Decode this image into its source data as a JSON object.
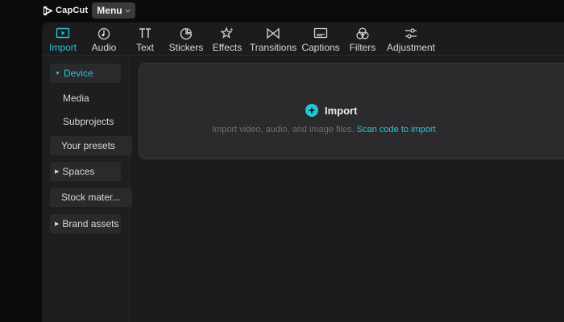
{
  "brand": {
    "name": "CapCut"
  },
  "menu": {
    "label": "Menu"
  },
  "toolbar": {
    "accent": "#2bc4d6",
    "items": [
      {
        "label": "Import",
        "icon": "import-icon",
        "active": true
      },
      {
        "label": "Audio",
        "icon": "audio-icon"
      },
      {
        "label": "Text",
        "icon": "text-icon"
      },
      {
        "label": "Stickers",
        "icon": "stickers-icon"
      },
      {
        "label": "Effects",
        "icon": "effects-icon"
      },
      {
        "label": "Transitions",
        "icon": "transitions-icon"
      },
      {
        "label": "Captions",
        "icon": "captions-icon"
      },
      {
        "label": "Filters",
        "icon": "filters-icon"
      },
      {
        "label": "Adjustment",
        "icon": "adjustment-icon"
      }
    ]
  },
  "sidebar": {
    "items": [
      {
        "label": "Device",
        "expanded": true,
        "selected": true
      },
      {
        "label": "Media"
      },
      {
        "label": "Subprojects"
      },
      {
        "label": "Your presets"
      },
      {
        "label": "Spaces",
        "collapsed": true
      },
      {
        "label": "Stock mater..."
      },
      {
        "label": "Brand assets",
        "collapsed": true
      }
    ]
  },
  "import_panel": {
    "button_label": "Import",
    "hint": "Import video, audio, and image files.",
    "scan_link": "Scan code to import"
  }
}
